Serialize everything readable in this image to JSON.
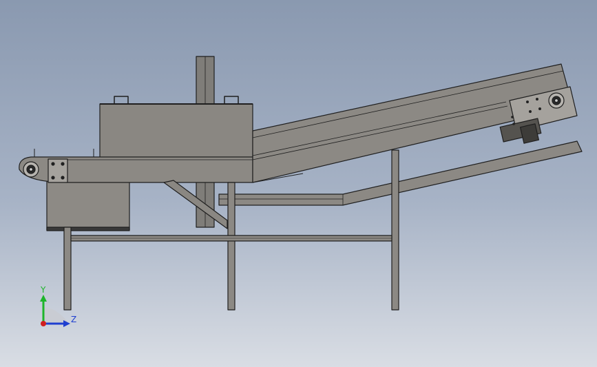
{
  "view": {
    "background_top": "#8a99b0",
    "background_bottom": "#d9dde4",
    "part_fill": "#8c8984",
    "part_edge": "#1e1e1e"
  },
  "triad": {
    "y_label": "Y",
    "z_label": "Z",
    "y_color": "#1db52a",
    "z_color": "#1f3fd0",
    "x_color": "#d01f1f"
  }
}
